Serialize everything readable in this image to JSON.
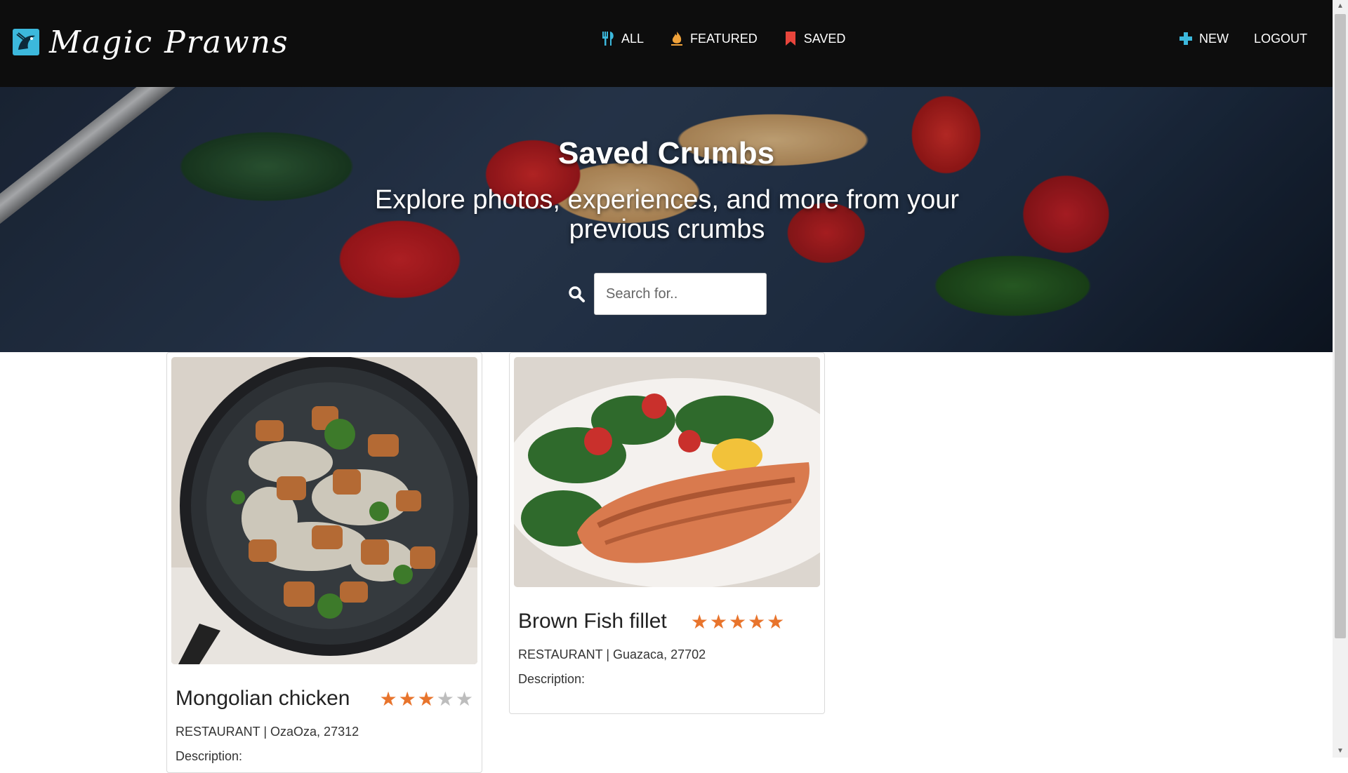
{
  "brand": {
    "name": "Magic Prawns",
    "logo_icon": "prawn-logo-icon"
  },
  "nav": {
    "center": [
      {
        "label": "ALL",
        "icon": "utensils-icon",
        "color": "#3cb8dc"
      },
      {
        "label": "FEATURED",
        "icon": "fire-icon",
        "color": "#f0a23a"
      },
      {
        "label": "SAVED",
        "icon": "bookmark-icon",
        "color": "#e8453c"
      }
    ],
    "right": [
      {
        "label": "NEW",
        "icon": "plus-icon",
        "color": "#3cb8dc"
      },
      {
        "label": "LOGOUT"
      }
    ]
  },
  "hero": {
    "title": "Saved Crumbs",
    "subtitle": "Explore photos, experiences, and more from your previous crumbs",
    "search_placeholder": "Search for.."
  },
  "cards": [
    {
      "title": "Mongolian chicken",
      "rating": 3,
      "max_rating": 5,
      "meta": "RESTAURANT | OzaOza, 27312",
      "description_label": "Description:"
    },
    {
      "title": "Brown Fish fillet",
      "rating": 5,
      "max_rating": 5,
      "meta": "RESTAURANT | Guazaca, 27702",
      "description_label": "Description:"
    }
  ],
  "colors": {
    "navbar_bg": "#0d0d0d",
    "accent": "#3cb8dc",
    "star": "#e8742c"
  }
}
